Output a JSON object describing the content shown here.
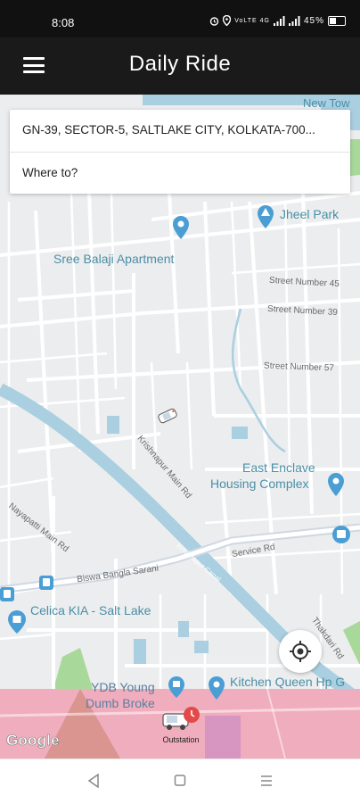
{
  "status_bar": {
    "time": "8:08",
    "icons": [
      "alarm-icon",
      "location-icon",
      "volte-icon",
      "signal-icon",
      "signal-icon"
    ],
    "indicators": "VoLTE 4G",
    "battery": "45%"
  },
  "app_bar": {
    "menu_icon": "hamburger-menu-icon",
    "title": "Daily Ride"
  },
  "location_card": {
    "pickup": "GN-39, SECTOR-5, SALTLAKE CITY, KOLKATA-700...",
    "destination_placeholder": "Where to?"
  },
  "map": {
    "places": {
      "sree_balaji": "Sree Balaji Apartment",
      "jheel_park": "Jheel Park",
      "east_enclave_1": "East Enclave",
      "east_enclave_2": "Housing Complex",
      "celica": "Celica KIA - Salt Lake",
      "ydb_1": "YDB Young",
      "ydb_2": "Dumb Broke",
      "kitchen_queen": "Kitchen Queen Hp G",
      "new_town": "New Tow"
    },
    "streets": {
      "sn45": "Street Number 45",
      "sn39": "Street Number 39",
      "sn57": "Street Number 57",
      "krishnapur": "Krishnapur Main Rd",
      "nayapatti": "Nayapatti Main Rd",
      "biswa": "Biswa Bangla Sarani",
      "service": "Service Rd",
      "thakdari": "Thakdari Rd",
      "canal": "Krishnapur Canal"
    },
    "colors": {
      "water": "#a9cfe0",
      "road": "#ffffff",
      "block": "#ecedee",
      "park": "#a8d99a",
      "panel": "#ec96aa"
    }
  },
  "controls": {
    "my_location_icon": "my-location-icon",
    "outstation_label": "Outstation",
    "google_logo": "Google"
  },
  "nav_bar": {
    "back_icon": "back-triangle-icon",
    "home_icon": "home-square-icon",
    "recents_icon": "recents-menu-icon"
  }
}
